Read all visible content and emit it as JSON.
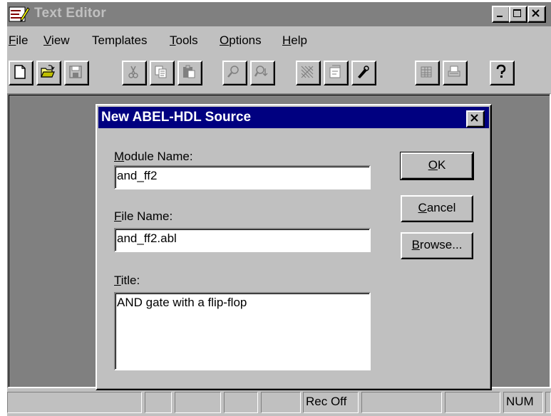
{
  "window": {
    "title": "Text Editor",
    "controls": [
      "minimize",
      "maximize",
      "close"
    ]
  },
  "menubar": {
    "items": [
      {
        "label": "File",
        "hotkey": "F"
      },
      {
        "label": "View",
        "hotkey": "V"
      },
      {
        "label": "Templates",
        "hotkey": ""
      },
      {
        "label": "Tools",
        "hotkey": "T"
      },
      {
        "label": "Options",
        "hotkey": "O"
      },
      {
        "label": "Help",
        "hotkey": "H"
      }
    ]
  },
  "toolbar": {
    "buttons": [
      {
        "icon": "new-document-icon",
        "enabled": true
      },
      {
        "icon": "open-folder-icon",
        "enabled": true
      },
      {
        "icon": "save-icon",
        "enabled": false
      },
      {
        "icon": "cut-icon",
        "enabled": false
      },
      {
        "icon": "copy-icon",
        "enabled": false
      },
      {
        "icon": "paste-icon",
        "enabled": false
      },
      {
        "icon": "find-icon",
        "enabled": false
      },
      {
        "icon": "find-next-icon",
        "enabled": false
      },
      {
        "icon": "hatch-icon",
        "enabled": false
      },
      {
        "icon": "template-icon",
        "enabled": false
      },
      {
        "icon": "edit-icon",
        "enabled": true
      },
      {
        "icon": "grid-icon",
        "enabled": false
      },
      {
        "icon": "print-icon",
        "enabled": false
      },
      {
        "icon": "help-icon",
        "enabled": true
      }
    ]
  },
  "dialog": {
    "title": "New ABEL-HDL Source",
    "module_name_label": "Module Name:",
    "module_name_value": "and_ff2",
    "file_name_label": "File Name:",
    "file_name_value": "and_ff2.abl",
    "title_label": "Title:",
    "title_value": "AND gate with a flip-flop",
    "ok_label": "OK",
    "cancel_label": "Cancel",
    "browse_label": "Browse..."
  },
  "statusbar": {
    "panes": [
      "",
      "",
      "",
      "",
      "",
      "Rec Off",
      "",
      "",
      "NUM",
      ""
    ]
  },
  "colors": {
    "face": "#c0c0c0",
    "client": "#808080",
    "dialog_title": "#000080",
    "inactive_title": "#808080"
  }
}
